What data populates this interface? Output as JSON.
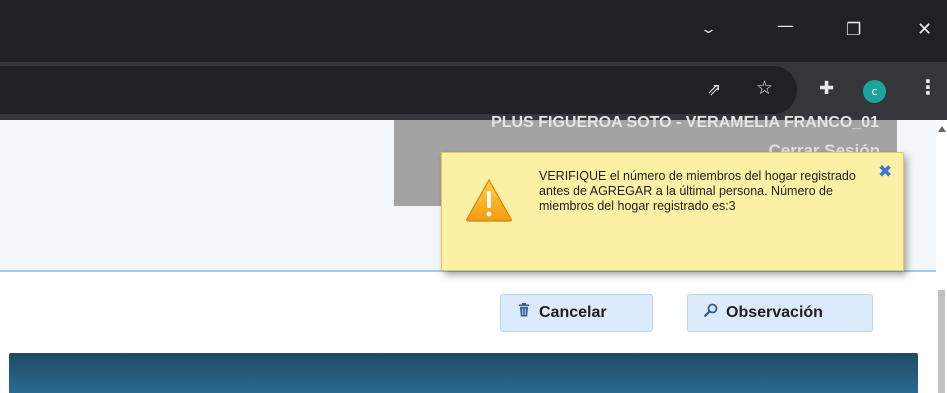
{
  "window": {
    "chevron_label": "⌄",
    "minimize_label": "—",
    "restore_label": "❐",
    "close_label": "✕"
  },
  "toolbar": {
    "share_icon": "⇗",
    "star_icon": "☆",
    "extensions_icon": "✚",
    "avatar_letter": "c",
    "avatar_color": "#1ba39c",
    "menu_icon": "⋮"
  },
  "header": {
    "user_name": "PLUS FIGUEROA SOTO - VERAMELIA FRANCO_01",
    "logout_label": "Cerrar Sesión"
  },
  "buttons": {
    "cancel_label": "Cancelar",
    "cancel_icon": "trash-icon",
    "observation_label": "Observación",
    "observation_icon": "search-icon"
  },
  "alert": {
    "message": "VERIFIQUE el número de miembros del hogar registrado antes de AGREGAR a la últimal persona. Número de miembros del hogar registrado es:3",
    "close_label": "✖",
    "background_color": "#fbf0a3"
  }
}
